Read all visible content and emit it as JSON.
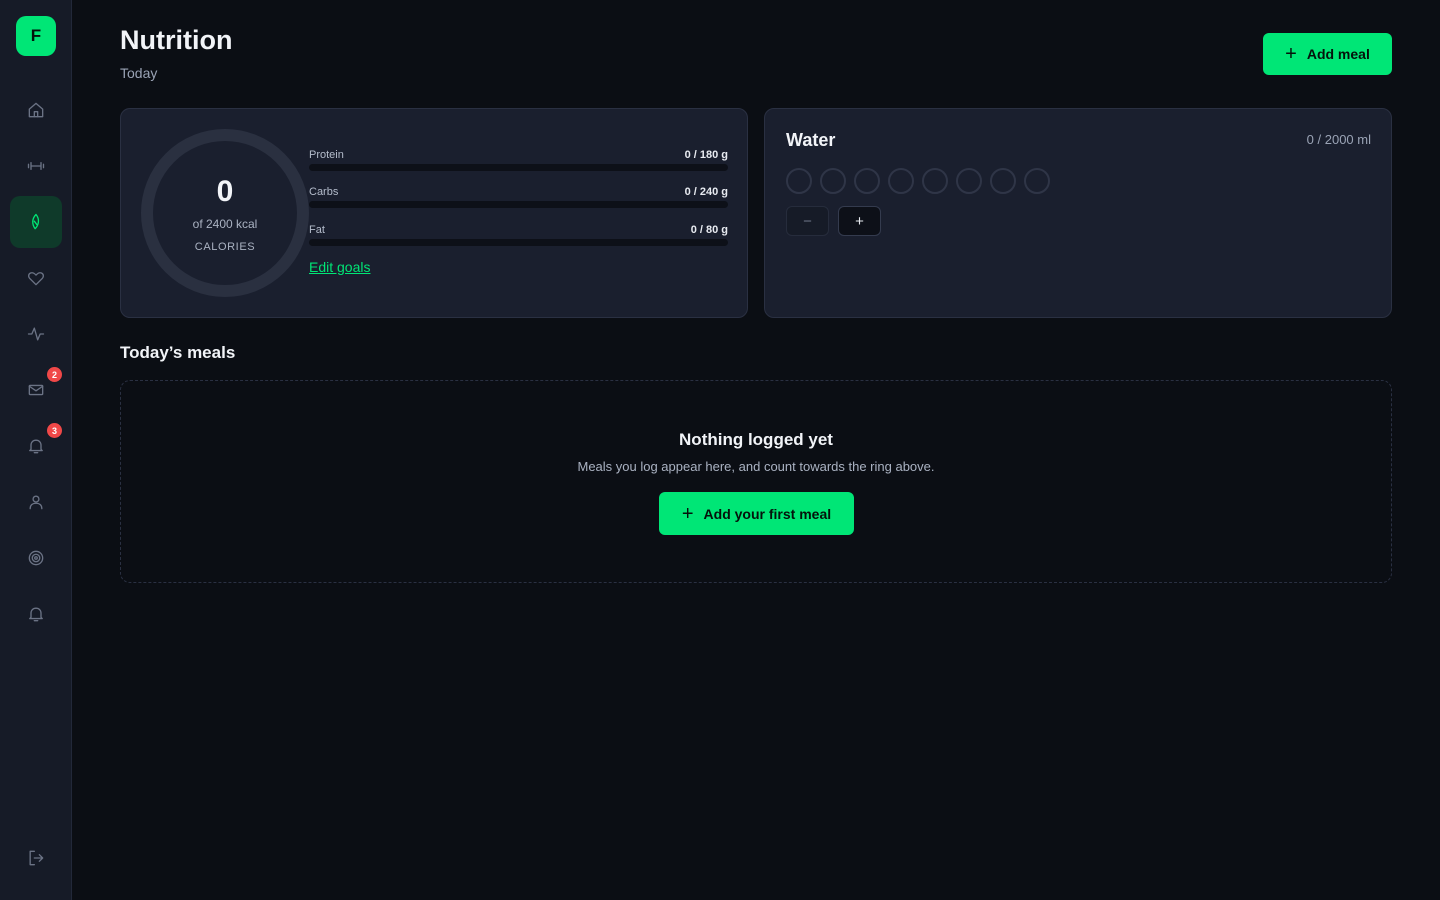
{
  "app": {
    "logo_letter": "F"
  },
  "sidebar": {
    "items": [
      {
        "icon": "home-icon"
      },
      {
        "icon": "dumbbell-icon"
      },
      {
        "icon": "leaf-icon",
        "active": true
      },
      {
        "icon": "heart-icon"
      },
      {
        "icon": "activity-icon"
      },
      {
        "icon": "mail-icon",
        "badge": "2"
      },
      {
        "icon": "bell-icon",
        "badge": "3"
      },
      {
        "icon": "user-icon"
      },
      {
        "icon": "target-icon"
      },
      {
        "icon": "bell-icon"
      }
    ],
    "logout_icon": "logout-icon"
  },
  "header": {
    "title": "Nutrition",
    "subtitle": "Today",
    "add_meal_label": "Add meal"
  },
  "calories": {
    "value": "0",
    "of_text": "of 2400 kcal",
    "label": "CALORIES",
    "progress": 0
  },
  "macros": [
    {
      "name": "Protein",
      "value": "0 / 180 g",
      "progress": 0
    },
    {
      "name": "Carbs",
      "value": "0 / 240 g",
      "progress": 0
    },
    {
      "name": "Fat",
      "value": "0 / 80 g",
      "progress": 0
    }
  ],
  "edit_goals_label": "Edit goals",
  "water": {
    "title": "Water",
    "amount": "0 / 2000 ml",
    "cups_total": 8,
    "cups_filled": 0,
    "minus_label": "−",
    "plus_label": "+"
  },
  "meals": {
    "title": "Today’s meals",
    "empty_title": "Nothing logged yet",
    "empty_description": "Meals you log appear here, and count towards the ring above.",
    "add_first_label": "Add your first meal"
  },
  "colors": {
    "accent": "#00e676",
    "background": "#0b0e14",
    "card": "#1a1f2e",
    "badge": "#f04848"
  }
}
